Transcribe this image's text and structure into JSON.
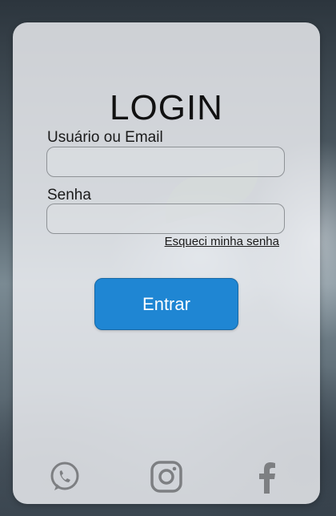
{
  "login": {
    "title": "LOGIN",
    "user_label": "Usuário ou Email",
    "user_value": "",
    "password_label": "Senha",
    "password_value": "",
    "forgot_link": "Esqueci minha senha",
    "submit_label": "Entrar"
  },
  "social": {
    "icons": [
      "whatsapp-icon",
      "instagram-icon",
      "facebook-icon"
    ],
    "icon_color": "#7d7f82"
  },
  "colors": {
    "accent": "#1f86d3"
  }
}
